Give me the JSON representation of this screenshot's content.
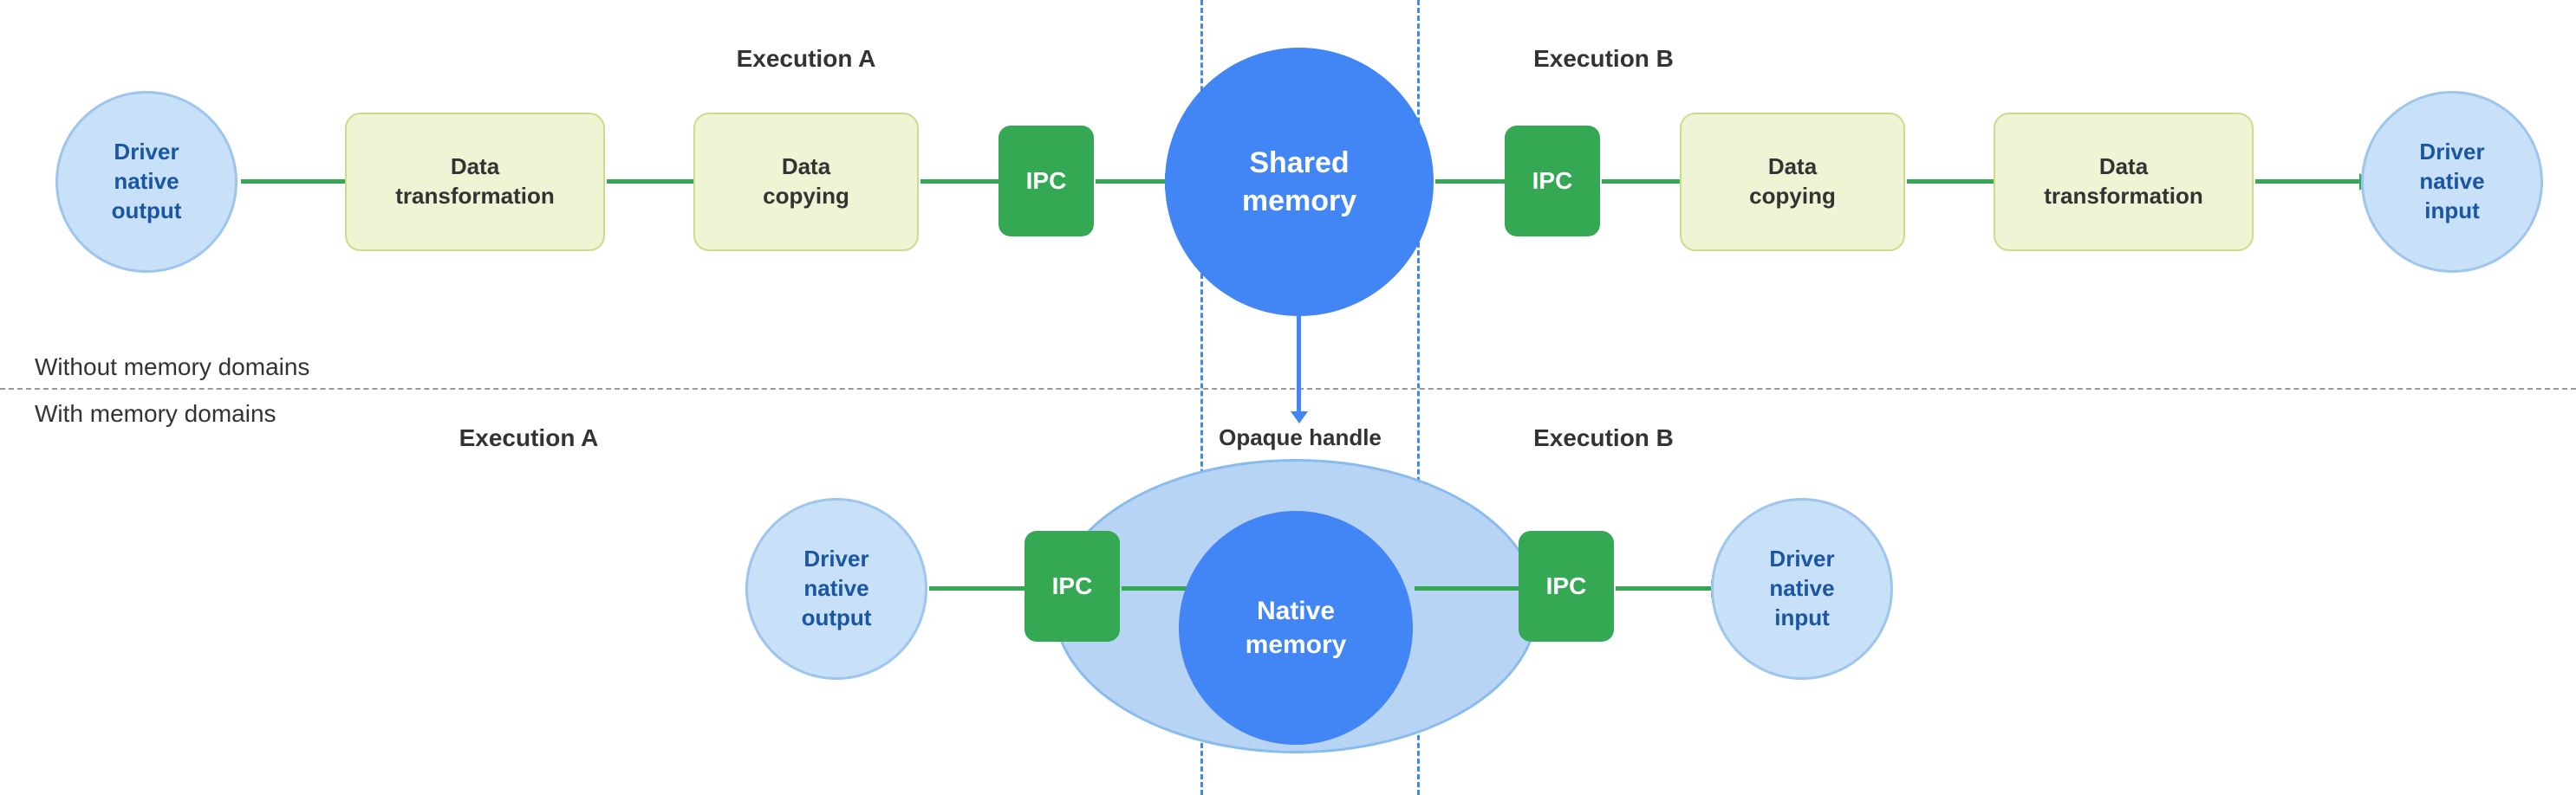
{
  "sections": {
    "without": "Without memory domains",
    "with": "With memory domains"
  },
  "top_row": {
    "exec_a_label": "Execution A",
    "exec_b_label": "Execution B",
    "nodes": [
      {
        "id": "driver-native-output-top",
        "text": "Driver\nnative\noutput",
        "type": "circle-blue"
      },
      {
        "id": "data-transform-1",
        "text": "Data\ntransformation",
        "type": "rect-yellow"
      },
      {
        "id": "data-copying-1",
        "text": "Data\ncopying",
        "type": "rect-yellow"
      },
      {
        "id": "ipc-1",
        "text": "IPC",
        "type": "rect-green"
      },
      {
        "id": "shared-memory",
        "text": "Shared\nmemory",
        "type": "circle-bright"
      },
      {
        "id": "ipc-2",
        "text": "IPC",
        "type": "rect-green"
      },
      {
        "id": "data-copying-2",
        "text": "Data\ncopying",
        "type": "rect-yellow"
      },
      {
        "id": "data-transform-2",
        "text": "Data\ntransformation",
        "type": "rect-yellow"
      },
      {
        "id": "driver-native-input-top",
        "text": "Driver\nnative\ninput",
        "type": "circle-blue"
      }
    ]
  },
  "bottom_row": {
    "exec_a_label": "Execution A",
    "exec_b_label": "Execution B",
    "opaque_label": "Opaque handle",
    "nodes": [
      {
        "id": "driver-native-output-bot",
        "text": "Driver\nnative\noutput",
        "type": "circle-blue"
      },
      {
        "id": "ipc-3",
        "text": "IPC",
        "type": "rect-green"
      },
      {
        "id": "native-memory",
        "text": "Native\nmemory",
        "type": "circle-native"
      },
      {
        "id": "ipc-4",
        "text": "IPC",
        "type": "rect-green"
      },
      {
        "id": "driver-native-input-bot",
        "text": "Driver\nnative\ninput",
        "type": "circle-blue"
      }
    ]
  },
  "colors": {
    "circle_blue_bg": "#c8e0f8",
    "circle_blue_border": "#9ec5ee",
    "circle_blue_text": "#1a56a4",
    "rect_yellow_bg": "#eef4d4",
    "rect_yellow_border": "#c8dc8c",
    "rect_green_bg": "#34a853",
    "circle_bright_bg": "#4285f4",
    "vdash_color": "#4285f4",
    "arrow_color": "#34a853"
  }
}
